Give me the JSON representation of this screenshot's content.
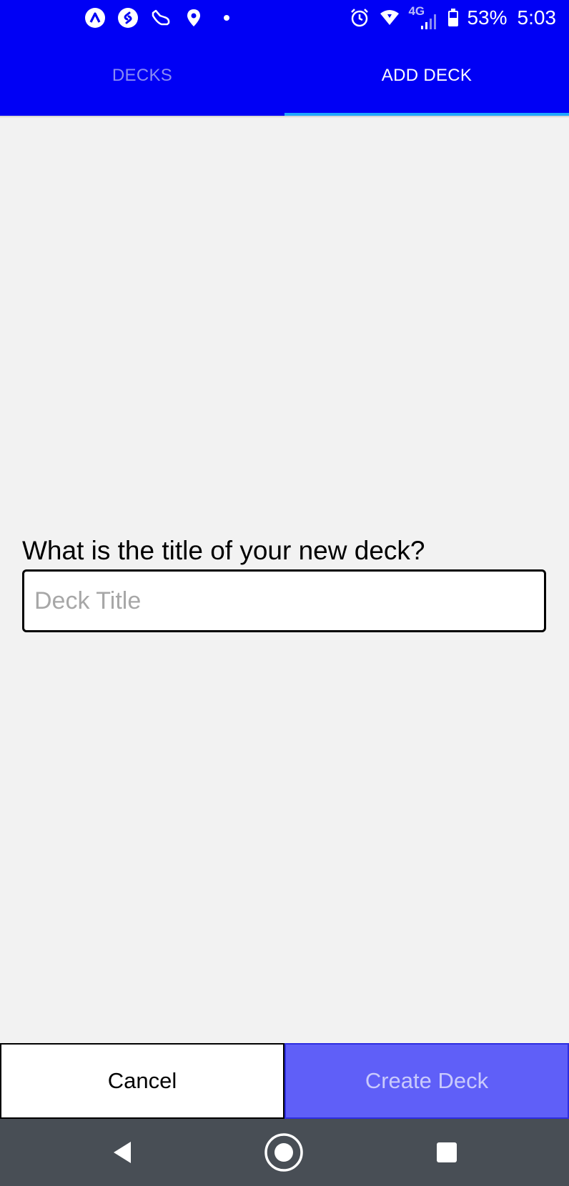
{
  "status_bar": {
    "left_icons": [
      "expo-icon",
      "shazam-icon",
      "shoe-icon",
      "location-icon",
      "dot-icon"
    ],
    "right_icons": [
      "alarm-icon",
      "wifi-icon",
      "network-4g-icon",
      "signal-icon",
      "battery-icon"
    ],
    "network_label": "4G",
    "battery": "53%",
    "time": "5:03"
  },
  "tabs": [
    {
      "label": "DECKS",
      "active": false
    },
    {
      "label": "ADD DECK",
      "active": true
    }
  ],
  "colors": {
    "primary": "#0000f5",
    "indicator": "#20a7ff",
    "create_button": "#5f5ff8",
    "nav_bar": "#484e55"
  },
  "form": {
    "question": "What is the title of your new deck?",
    "input_placeholder": "Deck Title",
    "input_value": ""
  },
  "actions": {
    "cancel_label": "Cancel",
    "create_label": "Create Deck"
  },
  "nav_bar": {
    "buttons": [
      "back-icon",
      "home-icon",
      "recents-icon"
    ]
  }
}
